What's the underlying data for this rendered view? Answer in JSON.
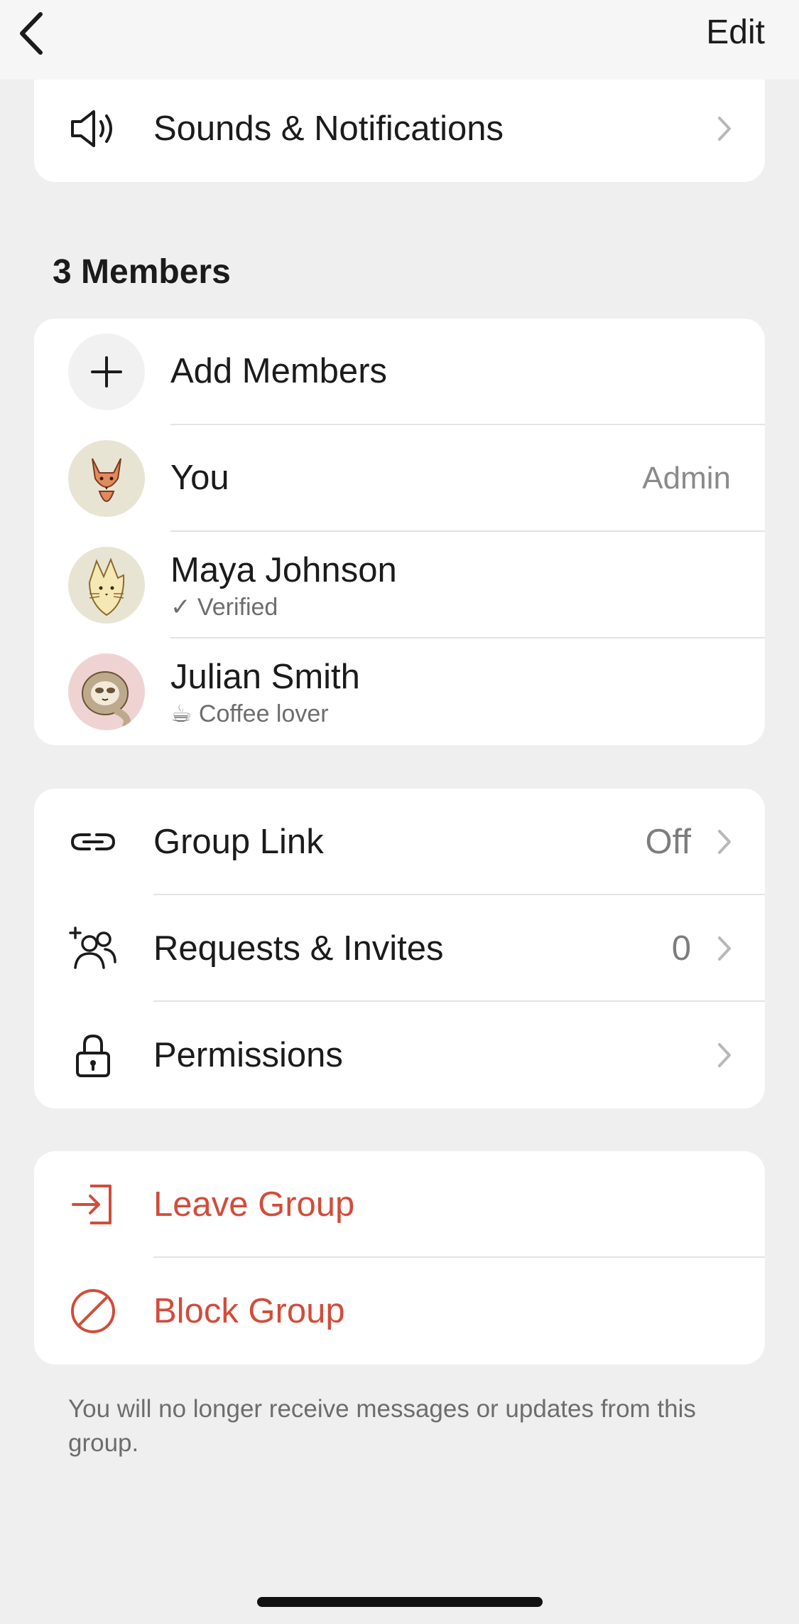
{
  "nav": {
    "edit_label": "Edit"
  },
  "settings": {
    "sounds_label": "Sounds & Notifications"
  },
  "members": {
    "title": "3 Members",
    "add_label": "Add Members",
    "list": [
      {
        "name": "You",
        "role": "Admin",
        "subtitle": ""
      },
      {
        "name": "Maya Johnson",
        "subtitle": "✓ Verified"
      },
      {
        "name": "Julian Smith",
        "subtitle": "☕ Coffee lover"
      }
    ]
  },
  "group": {
    "link_label": "Group Link",
    "link_value": "Off",
    "requests_label": "Requests & Invites",
    "requests_value": "0",
    "permissions_label": "Permissions"
  },
  "danger": {
    "leave_label": "Leave Group",
    "block_label": "Block Group",
    "footnote": "You will no longer receive messages or updates from this group."
  },
  "colors": {
    "danger": "#d24c3a",
    "background": "#efefef"
  }
}
